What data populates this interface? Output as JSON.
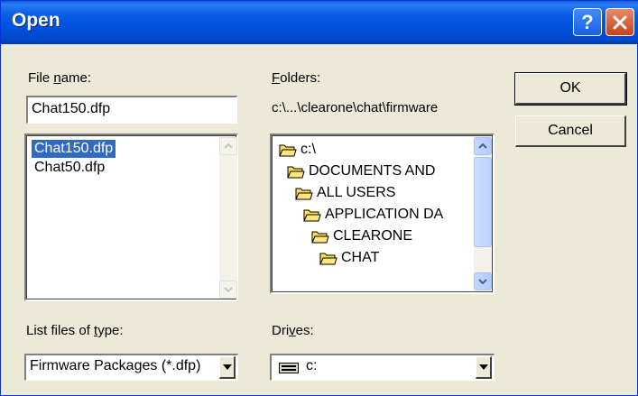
{
  "dialog": {
    "title": "Open",
    "help_label": "?",
    "close_label": "✕"
  },
  "file_name": {
    "label_pre": "File ",
    "label_accel": "n",
    "label_post": "ame:",
    "value": "Chat150.dfp"
  },
  "files": [
    {
      "name": "Chat150.dfp",
      "selected": true
    },
    {
      "name": "Chat50.dfp",
      "selected": false
    }
  ],
  "folders": {
    "label_accel": "F",
    "label_post": "olders:",
    "current_path": "c:\\...\\clearone\\chat\\firmware",
    "tree": [
      {
        "name": "c:\\",
        "level": 0
      },
      {
        "name": "DOCUMENTS AND",
        "level": 1
      },
      {
        "name": "ALL USERS",
        "level": 2
      },
      {
        "name": "APPLICATION DA",
        "level": 3
      },
      {
        "name": "CLEARONE",
        "level": 4
      },
      {
        "name": "CHAT",
        "level": 5
      }
    ]
  },
  "buttons": {
    "ok": "OK",
    "cancel": "Cancel"
  },
  "file_type": {
    "label_pre": "List files of ",
    "label_accel": "t",
    "label_post": "ype:",
    "value": "Firmware Packages (*.dfp)"
  },
  "drives": {
    "label_pre": "Dri",
    "label_accel": "v",
    "label_post": "es:",
    "value": "c:"
  },
  "icons": {
    "folder": "folder-open-icon",
    "drive": "hard-drive-icon",
    "scroll_up": "arrow-up-icon",
    "scroll_down": "arrow-down-icon",
    "dropdown": "dropdown-arrow-icon"
  },
  "colors": {
    "titlebar": "#0a5bd8",
    "selection": "#316ac5",
    "dialog_bg": "#ece9d8",
    "folder": "#ffdd55"
  }
}
